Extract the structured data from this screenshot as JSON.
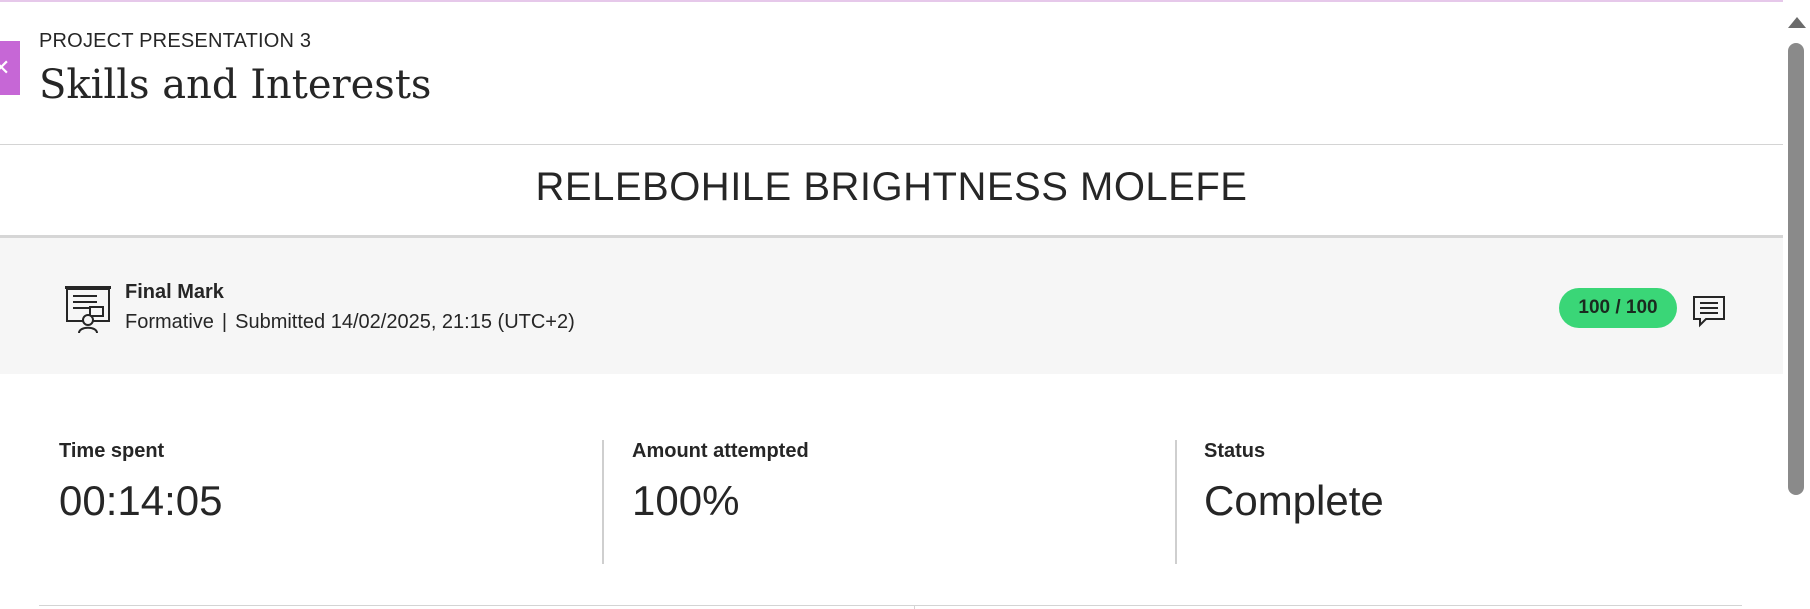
{
  "header": {
    "close_glyph": "✕",
    "eyebrow": "PROJECT PRESENTATION 3",
    "title": "Skills and Interests"
  },
  "student": {
    "name": "RELEBOHILE BRIGHTNESS MOLEFE"
  },
  "grade": {
    "icon": "assessment-icon",
    "label": "Final Mark",
    "type": "Formative",
    "separator": "|",
    "submitted": "Submitted 14/02/2025, 21:15 (UTC+2)",
    "score": "100 / 100",
    "pill_color": "#3ad677",
    "feedback_icon": "feedback-comment-icon"
  },
  "stats": [
    {
      "label": "Time spent",
      "value": "00:14:05"
    },
    {
      "label": "Amount attempted",
      "value": "100%"
    },
    {
      "label": "Status",
      "value": "Complete"
    }
  ],
  "colors": {
    "accent": "#c667d6",
    "success": "#3ad677"
  }
}
